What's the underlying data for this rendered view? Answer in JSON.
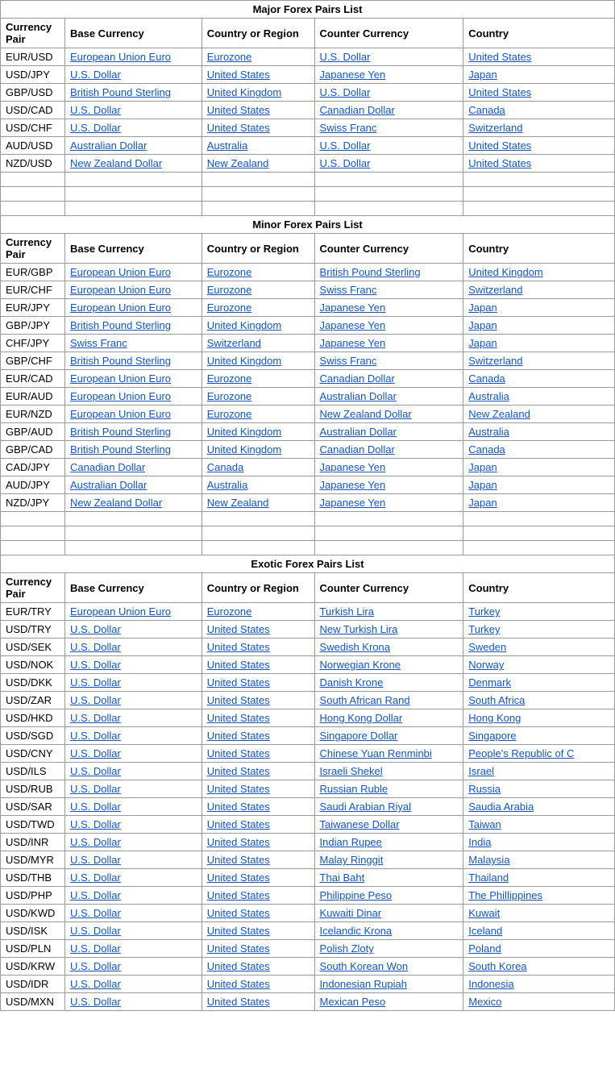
{
  "sections": [
    {
      "title": "Major Forex Pairs List",
      "headers": [
        "Currency Pair",
        "Base Currency",
        "Country or Region",
        "Counter Currency",
        "Country"
      ],
      "rows": [
        [
          "EUR/USD",
          "European Union Euro",
          "Eurozone",
          "U.S. Dollar",
          "United States"
        ],
        [
          "USD/JPY",
          "U.S. Dollar",
          "United States",
          "Japanese Yen",
          "Japan"
        ],
        [
          "GBP/USD",
          "British Pound Sterling",
          "United Kingdom",
          "U.S. Dollar",
          "United States"
        ],
        [
          "USD/CAD",
          "U.S. Dollar",
          "United States",
          "Canadian Dollar",
          "Canada"
        ],
        [
          "USD/CHF",
          "U.S. Dollar",
          "United States",
          "Swiss Franc",
          "Switzerland"
        ],
        [
          "AUD/USD",
          "Australian Dollar",
          "Australia",
          "U.S. Dollar",
          "United States"
        ],
        [
          "NZD/USD",
          "New Zealand Dollar",
          "New Zealand",
          "U.S. Dollar",
          "United States"
        ],
        [
          "",
          "",
          "",
          "",
          ""
        ],
        [
          "",
          "",
          "",
          "",
          ""
        ],
        [
          "",
          "",
          "",
          "",
          ""
        ]
      ]
    },
    {
      "title": "Minor Forex Pairs List",
      "headers": [
        "Currency Pair",
        "Base Currency",
        "Country or Region",
        "Counter Currency",
        "Country"
      ],
      "rows": [
        [
          "EUR/GBP",
          "European Union Euro",
          "Eurozone",
          "British Pound Sterling",
          "United Kingdom"
        ],
        [
          "EUR/CHF",
          "European Union Euro",
          "Eurozone",
          "Swiss Franc",
          "Switzerland"
        ],
        [
          "EUR/JPY",
          "European Union Euro",
          "Eurozone",
          "Japanese Yen",
          "Japan"
        ],
        [
          "GBP/JPY",
          "British Pound Sterling",
          "United Kingdom",
          "Japanese Yen",
          "Japan"
        ],
        [
          "CHF/JPY",
          "Swiss Franc",
          "Switzerland",
          "Japanese Yen",
          "Japan"
        ],
        [
          "GBP/CHF",
          "British Pound Sterling",
          "United Kingdom",
          "Swiss Franc",
          "Switzerland"
        ],
        [
          "EUR/CAD",
          "European Union Euro",
          "Eurozone",
          "Canadian Dollar",
          "Canada"
        ],
        [
          "EUR/AUD",
          "European Union Euro",
          "Eurozone",
          "Australian Dollar",
          "Australia"
        ],
        [
          "EUR/NZD",
          "European Union Euro",
          "Eurozone",
          "New Zealand Dollar",
          "New Zealand"
        ],
        [
          "GBP/AUD",
          "British Pound Sterling",
          "United Kingdom",
          "Australian Dollar",
          "Australia"
        ],
        [
          "GBP/CAD",
          "British Pound Sterling",
          "United Kingdom",
          "Canadian Dollar",
          "Canada"
        ],
        [
          "CAD/JPY",
          "Canadian Dollar",
          "Canada",
          "Japanese Yen",
          "Japan"
        ],
        [
          "AUD/JPY",
          "Australian Dollar",
          "Australia",
          "Japanese Yen",
          "Japan"
        ],
        [
          "NZD/JPY",
          "New Zealand Dollar",
          "New Zealand",
          "Japanese Yen",
          "Japan"
        ],
        [
          "",
          "",
          "",
          "",
          ""
        ],
        [
          "",
          "",
          "",
          "",
          ""
        ],
        [
          "",
          "",
          "",
          "",
          ""
        ]
      ]
    },
    {
      "title": "Exotic Forex Pairs List",
      "headers": [
        "Currency Pair",
        "Base Currency",
        "Country or Region",
        "Counter Currency",
        "Country"
      ],
      "rows": [
        [
          "EUR/TRY",
          "European Union Euro",
          "Eurozone",
          "Turkish Lira",
          "Turkey"
        ],
        [
          "USD/TRY",
          "U.S. Dollar",
          "United States",
          "New Turkish Lira",
          "Turkey"
        ],
        [
          "USD/SEK",
          "U.S. Dollar",
          "United States",
          "Swedish Krona",
          "Sweden"
        ],
        [
          "USD/NOK",
          "U.S. Dollar",
          "United States",
          "Norwegian Krone",
          "Norway"
        ],
        [
          "USD/DKK",
          "U.S. Dollar",
          "United States",
          "Danish Krone",
          "Denmark"
        ],
        [
          "USD/ZAR",
          "U.S. Dollar",
          "United States",
          "South African Rand",
          "South Africa"
        ],
        [
          "USD/HKD",
          "U.S. Dollar",
          "United States",
          "Hong Kong Dollar",
          "Hong Kong"
        ],
        [
          "USD/SGD",
          "U.S. Dollar",
          "United States",
          "Singapore Dollar",
          "Singapore"
        ],
        [
          "USD/CNY",
          "U.S. Dollar",
          "United States",
          "Chinese Yuan Renminbi",
          "People's Republic of C"
        ],
        [
          "USD/ILS",
          "U.S. Dollar",
          "United States",
          "Israeli Shekel",
          "Israel"
        ],
        [
          "USD/RUB",
          "U.S. Dollar",
          "United States",
          "Russian Ruble",
          "Russia"
        ],
        [
          "USD/SAR",
          "U.S. Dollar",
          "United States",
          "Saudi Arabian Riyal",
          "Saudia Arabia"
        ],
        [
          "USD/TWD",
          "U.S. Dollar",
          "United States",
          "Taiwanese Dollar",
          "Taiwan"
        ],
        [
          "USD/INR",
          "U.S. Dollar",
          "United States",
          "Indian Rupee",
          "India"
        ],
        [
          "USD/MYR",
          "U.S. Dollar",
          "United States",
          "Malay Ringgit",
          "Malaysia"
        ],
        [
          "USD/THB",
          "U.S. Dollar",
          "United States",
          "Thai Baht",
          "Thailand"
        ],
        [
          "USD/PHP",
          "U.S. Dollar",
          "United States",
          "Philippine Peso",
          "The Phillippines"
        ],
        [
          "USD/KWD",
          "U.S. Dollar",
          "United States",
          "Kuwaiti Dinar",
          "Kuwait"
        ],
        [
          "USD/ISK",
          "U.S. Dollar",
          "United States",
          "Icelandic Krona",
          "Iceland"
        ],
        [
          "USD/PLN",
          "U.S. Dollar",
          "United States",
          "Polish Zloty",
          "Poland"
        ],
        [
          "USD/KRW",
          "U.S. Dollar",
          "United States",
          "South Korean Won",
          "South Korea"
        ],
        [
          "USD/IDR",
          "U.S. Dollar",
          "United States",
          "Indonesian Rupiah",
          "Indonesia"
        ],
        [
          "USD/MXN",
          "U.S. Dollar",
          "United States",
          "Mexican Peso",
          "Mexico"
        ]
      ]
    }
  ],
  "blueColumns": {
    "baseCurrency": true,
    "countryOrRegion": true,
    "counterCurrency": true,
    "country": true
  }
}
